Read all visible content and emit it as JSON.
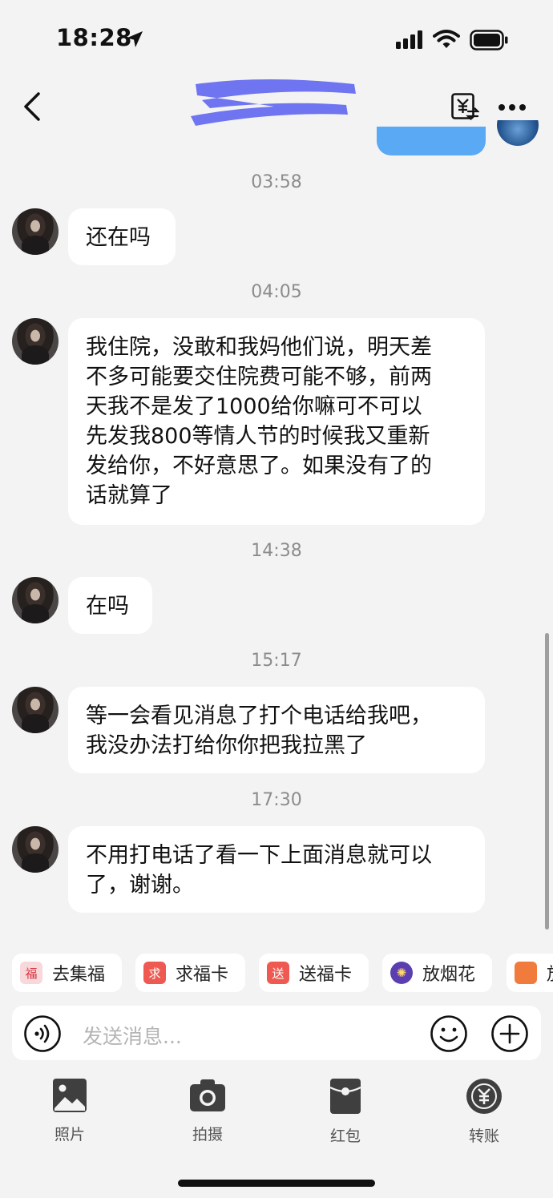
{
  "status_bar": {
    "time": "18:28"
  },
  "header": {
    "contact_name_redacted": true
  },
  "chat": {
    "messages": [
      {
        "timestamp": "03:58",
        "text": "还在吗"
      },
      {
        "timestamp": "04:05",
        "text": "我住院，没敢和我妈他们说，明天差\n不多可能要交住院费可能不够，前两\n天我不是发了1000给你嘛可不可以\n先发我800等情人节的时候我又重新\n发给你，不好意思了。如果没有了的\n话就算了"
      },
      {
        "timestamp": "14:38",
        "text": "在吗"
      },
      {
        "timestamp": "15:17",
        "text": "等一会看见消息了打个电话给我吧，\n我没办法打给你你把我拉黑了"
      },
      {
        "timestamp": "17:30",
        "text": "不用打电话了看一下上面消息就可以\n了，谢谢。"
      }
    ]
  },
  "quick_actions": [
    {
      "label": "去集福",
      "badge": "福",
      "badge_color": "#f7d9dc",
      "badge_text_color": "#d8343f"
    },
    {
      "label": "求福卡",
      "badge": "求",
      "badge_color": "#ee5a52",
      "badge_text_color": "#ffffff"
    },
    {
      "label": "送福卡",
      "badge": "送",
      "badge_color": "#ee5a52",
      "badge_text_color": "#ffffff"
    },
    {
      "label": "放烟花",
      "badge": "✺",
      "badge_color": "#5b3fb0",
      "badge_text_color": "#ffd86a"
    },
    {
      "label": "放",
      "badge": "",
      "badge_color": "#f07b3c",
      "badge_text_color": "#ffffff"
    }
  ],
  "input": {
    "placeholder": "发送消息..."
  },
  "bottom_actions": [
    {
      "label": "照片",
      "icon": "photo-icon"
    },
    {
      "label": "拍摄",
      "icon": "camera-icon"
    },
    {
      "label": "红包",
      "icon": "red-packet-icon"
    },
    {
      "label": "转账",
      "icon": "transfer-yuan-icon"
    }
  ],
  "colors": {
    "background": "#f3f3f3",
    "bubble": "#ffffff",
    "sent_bubble": "#5aa9f5",
    "name_mask": "#6f74f0",
    "timestamp": "#8c8c8c"
  }
}
